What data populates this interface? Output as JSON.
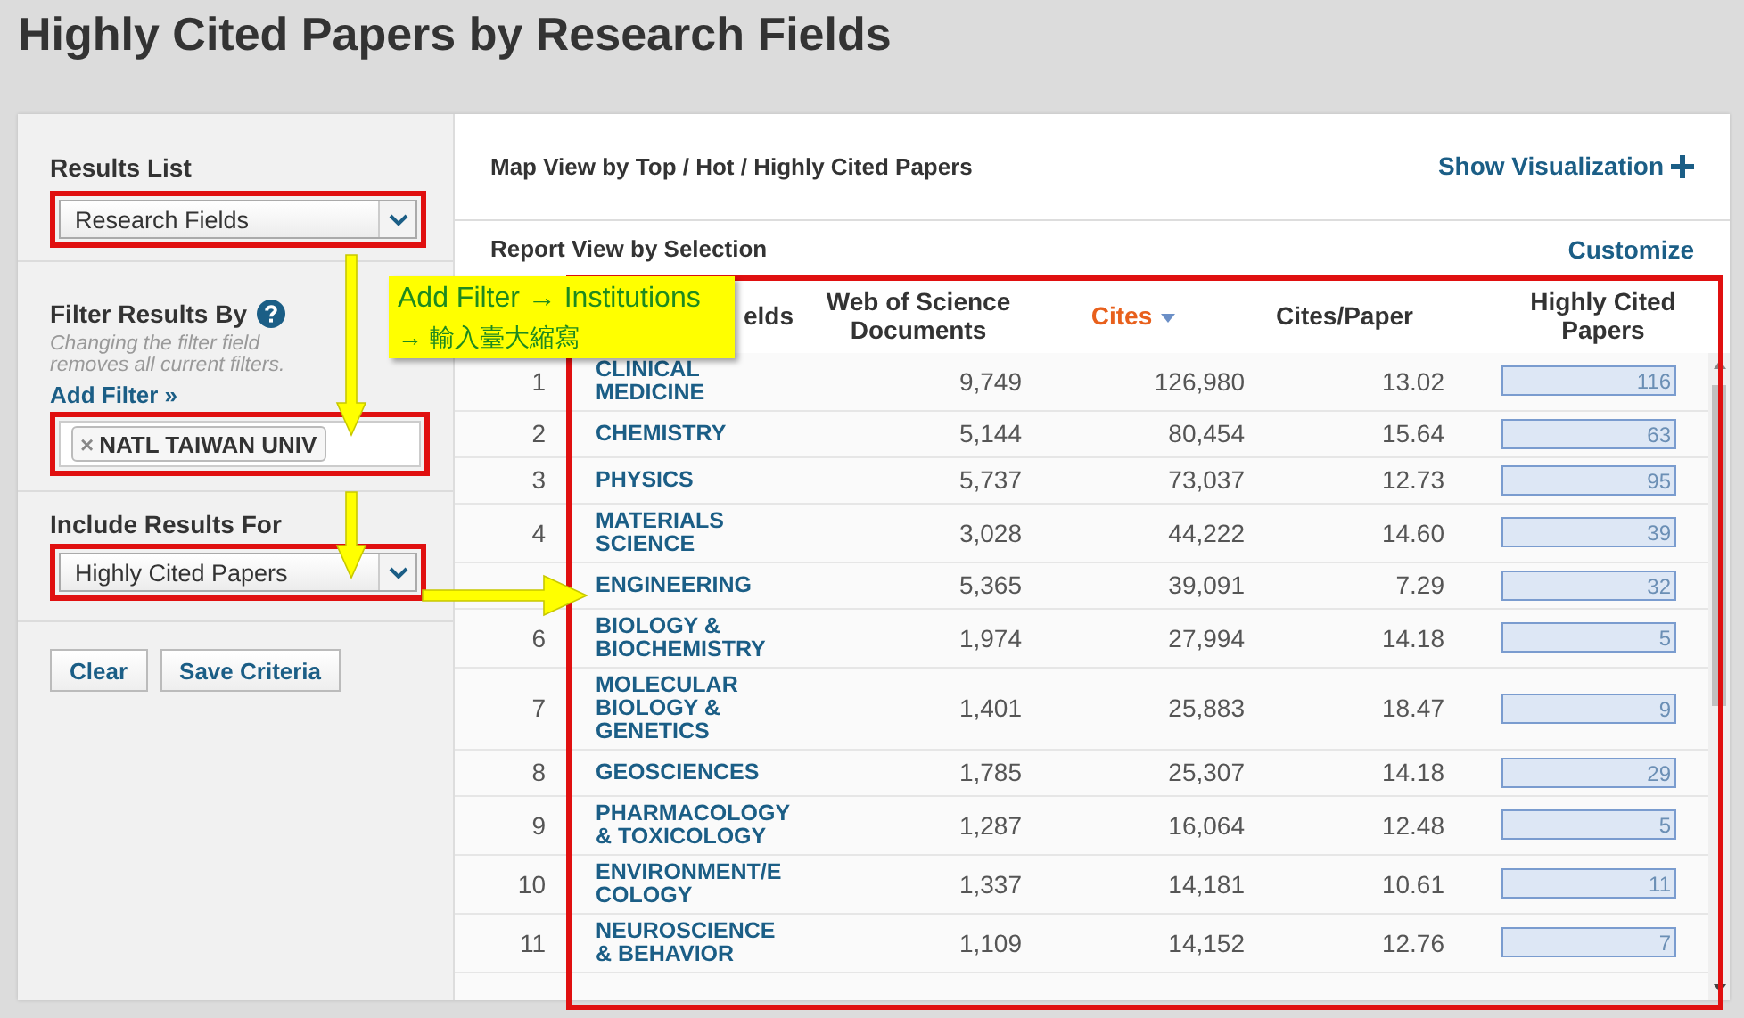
{
  "page_title": "Highly Cited Papers by Research Fields",
  "sidebar": {
    "results_list": {
      "label": "Results List",
      "value": "Research Fields"
    },
    "filter": {
      "label": "Filter Results By",
      "hint": "Changing the filter field removes all current filters.",
      "link": "Add Filter »",
      "chips": [
        {
          "remove": "×",
          "label": "NATL TAIWAN UNIV"
        }
      ]
    },
    "include": {
      "label": "Include Results For",
      "value": "Highly Cited Papers"
    },
    "buttons": [
      "Clear",
      "Save Criteria"
    ]
  },
  "map_view": {
    "title": "Map View by Top / Hot / Highly Cited Papers",
    "action": "Show Visualization"
  },
  "report": {
    "title": "Report View by Selection",
    "action": "Customize",
    "columns": [
      {
        "kind": "rank"
      },
      {
        "kind": "field",
        "label": "elds",
        "selected": false
      },
      {
        "kind": "number",
        "label": "Web of Science Documents",
        "selected": false
      },
      {
        "kind": "number",
        "label": "Cites",
        "selected": true
      },
      {
        "kind": "number",
        "label": "Cites/Paper",
        "selected": false
      },
      {
        "kind": "bar",
        "label": "Highly Cited Papers",
        "selected": false
      }
    ],
    "rows": [
      [
        "1",
        "CLINICAL MEDICINE",
        "9,749",
        "126,980",
        "13.02",
        "116"
      ],
      [
        "2",
        "CHEMISTRY",
        "5,144",
        "80,454",
        "15.64",
        "63"
      ],
      [
        "3",
        "PHYSICS",
        "5,737",
        "73,037",
        "12.73",
        "95"
      ],
      [
        "4",
        "MATERIALS SCIENCE",
        "3,028",
        "44,222",
        "14.60",
        "39"
      ],
      [
        null,
        "ENGINEERING",
        "5,365",
        "39,091",
        "7.29",
        "32"
      ],
      [
        "6",
        "BIOLOGY & BIOCHEMISTRY",
        "1,974",
        "27,994",
        "14.18",
        "5"
      ],
      [
        "7",
        "MOLECULAR BIOLOGY & GENETICS",
        "1,401",
        "25,883",
        "18.47",
        "9"
      ],
      [
        "8",
        "GEOSCIENCES",
        "1,785",
        "25,307",
        "14.18",
        "29"
      ],
      [
        "9",
        "PHARMACOLOGY & TOXICOLOGY",
        "1,287",
        "16,064",
        "12.48",
        "5"
      ],
      [
        "10",
        "ENVIRONMENT/ECOLOGY",
        "1,337",
        "14,181",
        "10.61",
        "11"
      ],
      [
        "11",
        "NEUROSCIENCE & BEHAVIOR",
        "1,109",
        "14,152",
        "12.76",
        "7"
      ]
    ]
  },
  "annotation": {
    "callout": [
      "Add Filter → Institutions",
      "→ 輸入臺大縮寫"
    ]
  }
}
